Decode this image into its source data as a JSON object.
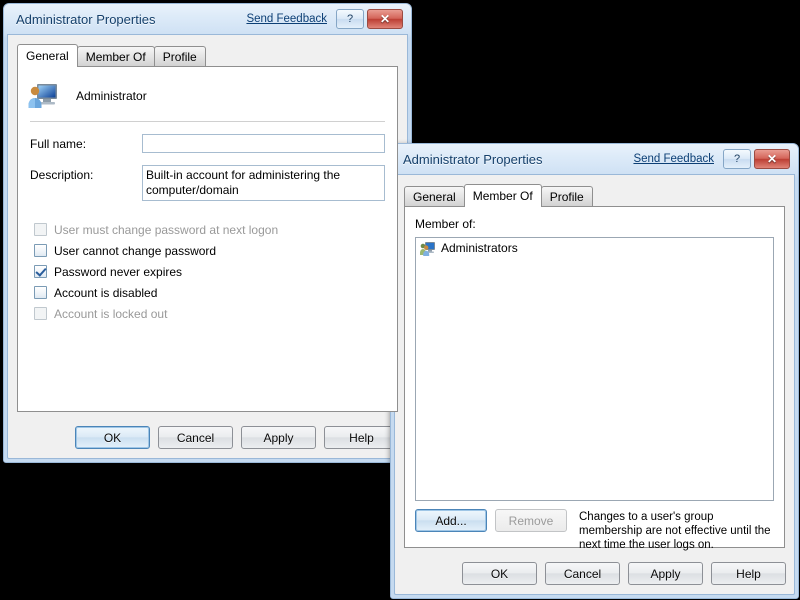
{
  "desktop": {
    "background": "#000000"
  },
  "window_general": {
    "title": "Administrator Properties",
    "send_feedback": "Send Feedback",
    "help_caption": "?",
    "close_caption": "✕",
    "tabs": [
      {
        "label": "General",
        "active": true
      },
      {
        "label": "Member Of",
        "active": false
      },
      {
        "label": "Profile",
        "active": false
      }
    ],
    "account_name": "Administrator",
    "fields": [
      {
        "label": "Full name:",
        "value": "",
        "multiline": false
      },
      {
        "label": "Description:",
        "value": "Built-in account for administering the computer/domain",
        "multiline": true
      }
    ],
    "checkboxes": [
      {
        "label": "User must change password at next logon",
        "checked": false,
        "disabled": true
      },
      {
        "label": "User cannot change password",
        "checked": false,
        "disabled": false
      },
      {
        "label": "Password never expires",
        "checked": true,
        "disabled": false
      },
      {
        "label": "Account is disabled",
        "checked": false,
        "disabled": false
      },
      {
        "label": "Account is locked out",
        "checked": false,
        "disabled": true
      }
    ],
    "buttons": [
      {
        "label": "OK",
        "style": "default"
      },
      {
        "label": "Cancel",
        "style": "normal"
      },
      {
        "label": "Apply",
        "style": "normal"
      },
      {
        "label": "Help",
        "style": "normal"
      }
    ]
  },
  "window_memberof": {
    "title": "Administrator Properties",
    "send_feedback": "Send Feedback",
    "help_caption": "?",
    "close_caption": "✕",
    "tabs": [
      {
        "label": "General",
        "active": false
      },
      {
        "label": "Member Of",
        "active": true
      },
      {
        "label": "Profile",
        "active": false
      }
    ],
    "member_of_label": "Member of:",
    "groups": [
      {
        "name": "Administrators",
        "icon": "group-icon"
      }
    ],
    "add_button": "Add...",
    "remove_button": "Remove",
    "note": "Changes to a user's group membership are not effective until the next time the user logs on.",
    "buttons": [
      {
        "label": "OK",
        "style": "normal"
      },
      {
        "label": "Cancel",
        "style": "normal"
      },
      {
        "label": "Apply",
        "style": "normal"
      },
      {
        "label": "Help",
        "style": "normal"
      }
    ]
  },
  "colors": {
    "title_text": "#15406b",
    "close_button": "#bc3f34",
    "link": "#0c3f75",
    "window_frame": "#c8dcf0",
    "client_bg": "#f0f0f0",
    "checkbox_check": "#2a5d9c"
  }
}
